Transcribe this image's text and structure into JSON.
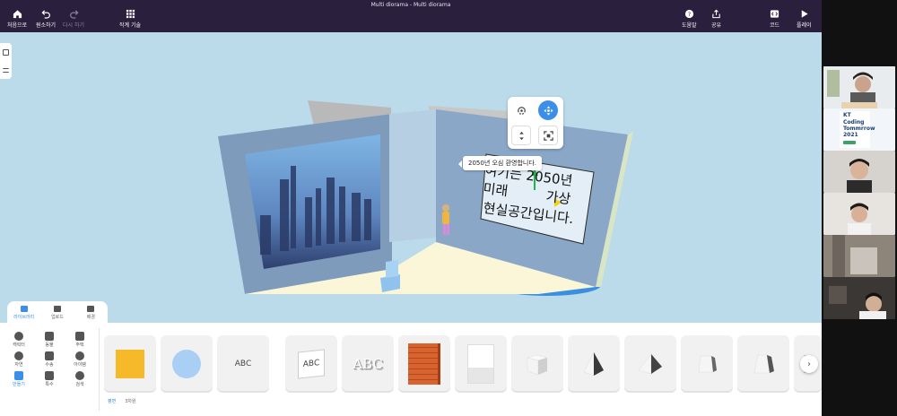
{
  "window": {
    "title": "Multi diorama - Multi diorama"
  },
  "toolbar": {
    "home": "처음으로",
    "undo": "원소하기",
    "redo": "다시 하기",
    "gallery": "작계 기술",
    "help": "도움말",
    "share": "공유",
    "code": "코드",
    "play": "플레이"
  },
  "scene": {
    "sign_lines": [
      "여기는 2050년",
      "미래",
      "가상",
      "현실공간입니다."
    ],
    "tooltip": "2050년 오심 환영합니다."
  },
  "library": {
    "tabs": [
      {
        "label": "라이브러리",
        "active": true
      },
      {
        "label": "업로드",
        "active": false
      },
      {
        "label": "배경",
        "active": false
      }
    ],
    "categories": [
      {
        "label": "캐릭터",
        "active": false
      },
      {
        "label": "동물",
        "active": false
      },
      {
        "label": "주택",
        "active": false
      },
      {
        "label": "자연",
        "active": false
      },
      {
        "label": "수송",
        "active": false
      },
      {
        "label": "아이템",
        "active": false
      },
      {
        "label": "만들기",
        "active": true
      },
      {
        "label": "특수",
        "active": false
      },
      {
        "label": "검색",
        "active": false
      }
    ],
    "sub_tabs": [
      {
        "label": "평면",
        "active": true
      },
      {
        "label": "3차원",
        "active": false
      }
    ],
    "item_text": {
      "abc_plain": "ABC",
      "abc_card": "ABC",
      "abc_3d": "ABC"
    }
  },
  "video": {
    "kt_logo": [
      "KT",
      "Coding",
      "Tommrrow",
      "2021"
    ]
  },
  "colors": {
    "toolbar_bg": "#2a1f3d",
    "viewport_bg": "#bcdbea",
    "accent": "#3b8fe6",
    "square_yellow": "#f6b92a",
    "circle_blue": "#a9cff5"
  }
}
